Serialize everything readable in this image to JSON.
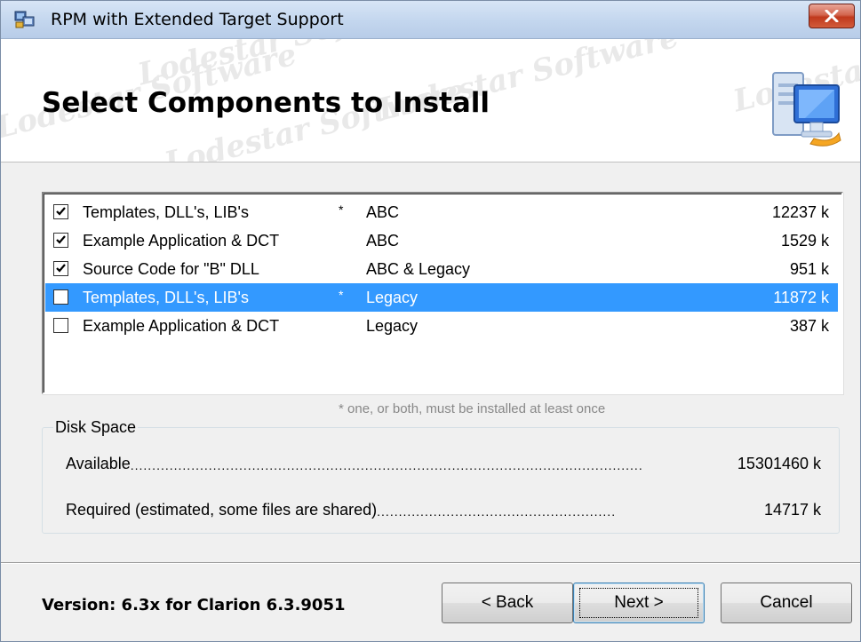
{
  "window": {
    "title": "RPM with Extended Target Support",
    "close_icon": "close-icon"
  },
  "banner": {
    "title": "Select Components to Install",
    "watermark": "Lodestar Software",
    "art_icon": "computer-setup-icon"
  },
  "components": [
    {
      "name": "Templates, DLL's, LIB's",
      "star": "*",
      "target": "ABC",
      "size": "12237 k",
      "checked": true,
      "selected": false
    },
    {
      "name": "Example Application & DCT",
      "star": "",
      "target": "ABC",
      "size": "1529 k",
      "checked": true,
      "selected": false
    },
    {
      "name": "Source Code for \"B\" DLL",
      "star": "",
      "target": "ABC & Legacy",
      "size": "951 k",
      "checked": true,
      "selected": false
    },
    {
      "name": "Templates, DLL's, LIB's",
      "star": "*",
      "target": "Legacy",
      "size": "11872 k",
      "checked": false,
      "selected": true
    },
    {
      "name": "Example Application & DCT",
      "star": "",
      "target": "Legacy",
      "size": "387 k",
      "checked": false,
      "selected": false
    }
  ],
  "note": "* one, or both, must be installed at least once",
  "disk_space": {
    "label": "Disk Space",
    "available_label": "Available",
    "available_value": "15301460 k",
    "required_label": "Required (estimated, some files are shared)",
    "required_value": "14717 k"
  },
  "footer": {
    "version": "Version: 6.3x for Clarion 6.3.9051",
    "back_label": "< Back",
    "next_label": "Next >",
    "cancel_label": "Cancel"
  },
  "colors": {
    "selection": "#3399ff",
    "titlebar": "#c3d6ee",
    "close_button": "#c0391d"
  }
}
